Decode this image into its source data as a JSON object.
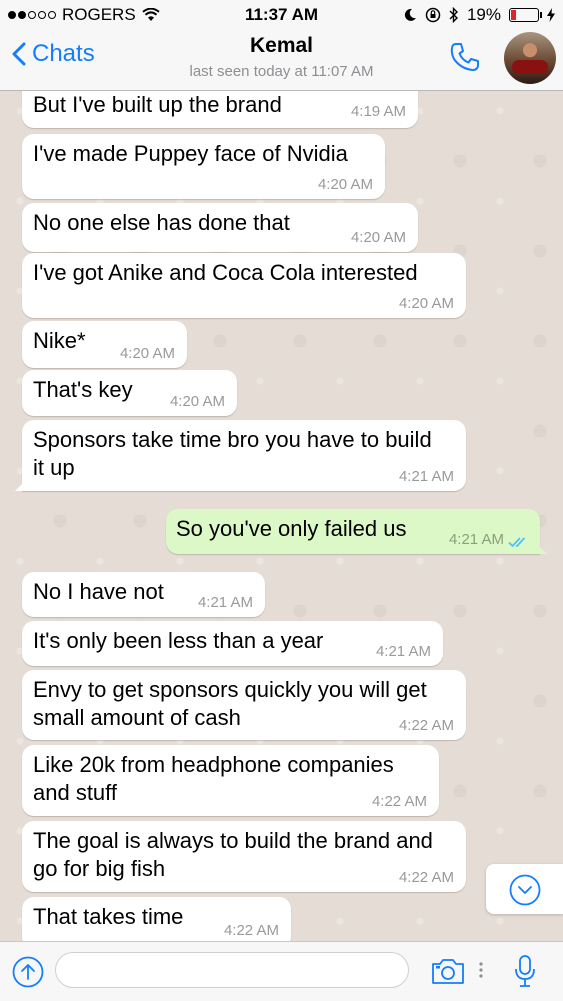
{
  "status_bar": {
    "carrier": "ROGERS",
    "time": "11:37 AM",
    "battery": "19%"
  },
  "header": {
    "back_label": "Chats",
    "contact_name": "Kemal",
    "last_seen": "last seen today at 11:07 AM"
  },
  "messages": [
    {
      "text": "But I've built up the brand",
      "time": "4:19 AM",
      "direction": "in"
    },
    {
      "text": "I've made Puppey face of Nvidia",
      "time": "4:20 AM",
      "direction": "in"
    },
    {
      "text": "No one else has done that",
      "time": "4:20 AM",
      "direction": "in"
    },
    {
      "text": "I've got Anike and Coca Cola interested",
      "time": "4:20 AM",
      "direction": "in"
    },
    {
      "text": "Nike*",
      "time": "4:20 AM",
      "direction": "in"
    },
    {
      "text": "That's key",
      "time": "4:20 AM",
      "direction": "in"
    },
    {
      "text": "Sponsors take time bro you have to build\nit up",
      "time": "4:21 AM",
      "direction": "in"
    },
    {
      "text": "So you've only failed us",
      "time": "4:21 AM",
      "direction": "out",
      "status": "read"
    },
    {
      "text": "No I have not",
      "time": "4:21 AM",
      "direction": "in"
    },
    {
      "text": "It's only been less than a year",
      "time": "4:21 AM",
      "direction": "in"
    },
    {
      "text": "Envy to get sponsors quickly you will get\nsmall amount of cash",
      "time": "4:22 AM",
      "direction": "in"
    },
    {
      "text": "Like 20k from headphone companies\nand stuff",
      "time": "4:22 AM",
      "direction": "in"
    },
    {
      "text": "The goal is always to build the brand and\ngo for big fish",
      "time": "4:22 AM",
      "direction": "in"
    },
    {
      "text": "That takes time",
      "time": "4:22 AM",
      "direction": "in"
    }
  ],
  "input": {
    "placeholder": "",
    "value": ""
  },
  "colors": {
    "accent": "#147efb",
    "incoming_bubble": "#ffffff",
    "outgoing_bubble": "#dcf8c6",
    "read_ticks": "#4fc3f7",
    "battery_low": "#e0242b"
  },
  "icons": {
    "back": "chevron-left-icon",
    "call": "phone-icon",
    "scroll_down": "chevron-down-circle-icon",
    "upload": "arrow-up-circle-icon",
    "camera": "camera-icon",
    "mic": "microphone-icon"
  }
}
